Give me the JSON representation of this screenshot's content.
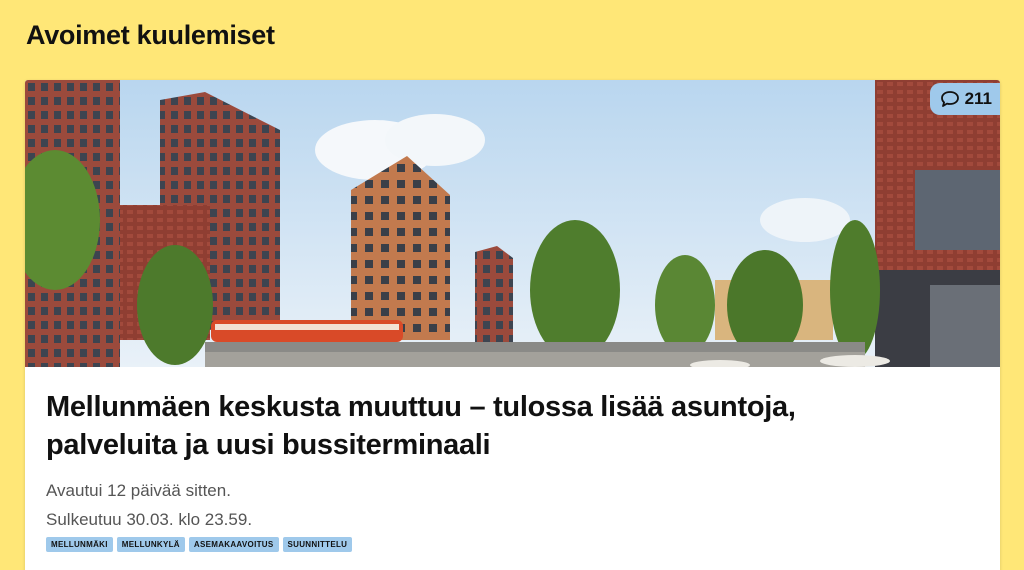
{
  "section": {
    "title": "Avoimet kuulemiset"
  },
  "card": {
    "comment_icon": "speech-bubble-icon",
    "comment_count": "211",
    "headline_line1": "Mellunmäen keskusta muuttuu – tulossa lisää asuntoja,",
    "headline_line2": "palveluita ja uusi bussiterminaali",
    "opened": "Avautui 12 päivää sitten.",
    "closes": "Sulkeutuu 30.03. klo 23.59.",
    "tags": [
      "MELLUNMÄKI",
      "MELLUNKYLÄ",
      "ASEMAKAAVOITUS",
      "SUUNNITTELU"
    ]
  },
  "colors": {
    "page_background": "#ffe777",
    "tag_background": "#9fc9eb",
    "badge_background": "#9fc9eb"
  }
}
